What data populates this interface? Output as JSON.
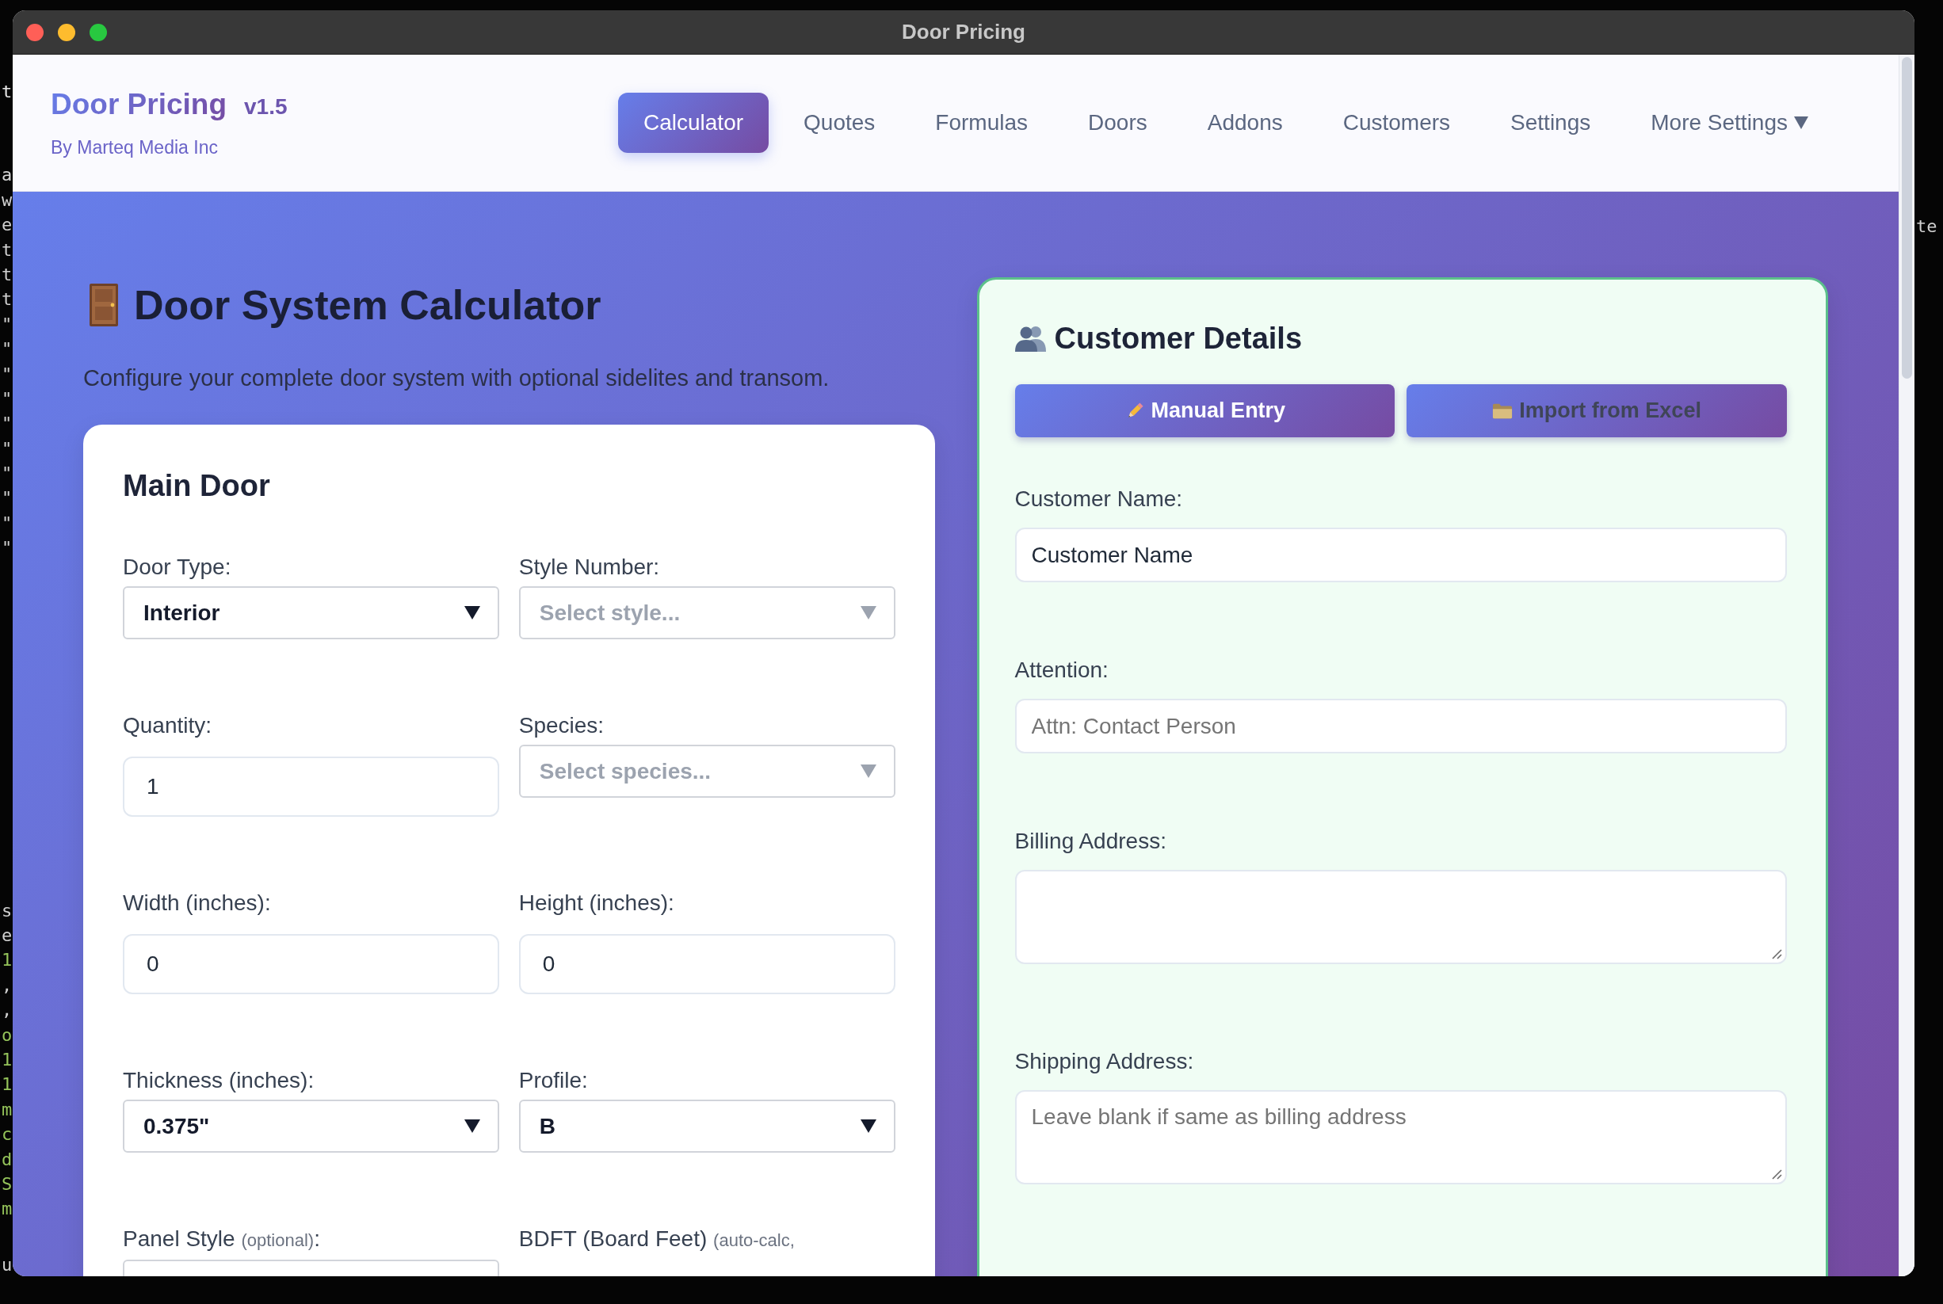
{
  "terminal_background": {
    "left_blocks": [
      {
        "lines": [
          {
            "text": "t",
            "color": "#e8e8e8"
          }
        ]
      },
      {
        "lines": [
          {
            "text": "a",
            "color": "#d8d8d8"
          },
          {
            "text": "w",
            "color": "#d0d0d0"
          },
          {
            "text": "e",
            "color": "#d0d0d0"
          },
          {
            "text": "t",
            "color": "#d0d0d0"
          },
          {
            "text": "t",
            "color": "#d0d0d0"
          },
          {
            "text": "t",
            "color": "#d0d0d0"
          },
          {
            "text": "\"",
            "color": "#d0d0d0"
          },
          {
            "text": "\"",
            "color": "#d0d0d0"
          },
          {
            "text": "\"",
            "color": "#d0d0d0"
          },
          {
            "text": "\"",
            "color": "#d0d0d0"
          },
          {
            "text": "\"",
            "color": "#d0d0d0"
          },
          {
            "text": "\"",
            "color": "#d0d0d0"
          },
          {
            "text": "\"",
            "color": "#d0d0d0"
          },
          {
            "text": "\"",
            "color": "#d0d0d0"
          },
          {
            "text": "\"",
            "color": "#d0d0d0"
          },
          {
            "text": "\"",
            "color": "#d0d0d0"
          }
        ]
      },
      {
        "lines": [
          {
            "text": "s",
            "color": "#d0d0d0"
          },
          {
            "text": "e",
            "color": "#d0d0d0"
          },
          {
            "text": "1",
            "color": "#94c35a"
          },
          {
            "text": ",",
            "color": "#d0d0d0"
          },
          {
            "text": ",",
            "color": "#d0d0d0"
          },
          {
            "text": "o",
            "color": "#94c35a"
          },
          {
            "text": "1",
            "color": "#94c35a"
          },
          {
            "text": "1",
            "color": "#94c35a"
          },
          {
            "text": "m",
            "color": "#94c35a"
          },
          {
            "text": "c",
            "color": "#94c35a"
          },
          {
            "text": "d",
            "color": "#94c35a"
          },
          {
            "text": "S",
            "color": "#94c35a"
          },
          {
            "text": "m",
            "color": "#94c35a"
          }
        ]
      },
      {
        "lines": [
          {
            "text": "u",
            "color": "#d0d0d0"
          }
        ]
      }
    ],
    "right_text": "te"
  },
  "window": {
    "title": "Door Pricing"
  },
  "header": {
    "app_name": "Door Pricing",
    "version": "v1.5",
    "byline": "By Marteq Media Inc",
    "nav": [
      {
        "label": "Calculator",
        "selected": true,
        "dropdown": false
      },
      {
        "label": "Quotes",
        "selected": false,
        "dropdown": false
      },
      {
        "label": "Formulas",
        "selected": false,
        "dropdown": false
      },
      {
        "label": "Doors",
        "selected": false,
        "dropdown": false
      },
      {
        "label": "Addons",
        "selected": false,
        "dropdown": false
      },
      {
        "label": "Customers",
        "selected": false,
        "dropdown": false
      },
      {
        "label": "Settings",
        "selected": false,
        "dropdown": false
      },
      {
        "label": "More Settings",
        "selected": false,
        "dropdown": true
      }
    ]
  },
  "calculator": {
    "title": "Door System Calculator",
    "subtitle": "Configure your complete door system with optional sidelites and transom.",
    "main_door": {
      "title": "Main Door",
      "fields": [
        {
          "kind": "select",
          "label": "Door Type:",
          "value": "Interior"
        },
        {
          "kind": "select",
          "label": "Style Number:",
          "placeholder": "Select style..."
        },
        {
          "kind": "input",
          "label": "Quantity:",
          "value": "1"
        },
        {
          "kind": "select",
          "label": "Species:",
          "placeholder": "Select species..."
        },
        {
          "kind": "input",
          "label": "Width (inches):",
          "value": "0"
        },
        {
          "kind": "input",
          "label": "Height (inches):",
          "value": "0"
        },
        {
          "kind": "select",
          "label": "Thickness (inches):",
          "value": "0.375\""
        },
        {
          "kind": "select",
          "label": "Profile:",
          "value": "B"
        },
        {
          "kind": "select",
          "label": "Panel Style",
          "note": "(optional)",
          "label_end": ":"
        },
        {
          "kind": "label",
          "label": "BDFT (Board Feet)",
          "note": "(auto-calc,"
        }
      ]
    }
  },
  "customer_details": {
    "title": "Customer Details",
    "modes": [
      {
        "label": "Manual Entry",
        "selected": true
      },
      {
        "label": "Import from Excel",
        "selected": false
      }
    ],
    "fields": [
      {
        "kind": "input",
        "label": "Customer Name:",
        "value": "Customer Name"
      },
      {
        "kind": "input",
        "label": "Attention:",
        "placeholder": "Attn: Contact Person"
      },
      {
        "kind": "textarea",
        "label": "Billing Address:"
      },
      {
        "kind": "textarea",
        "label": "Shipping Address:",
        "placeholder": "Leave blank if same as billing address"
      }
    ]
  }
}
